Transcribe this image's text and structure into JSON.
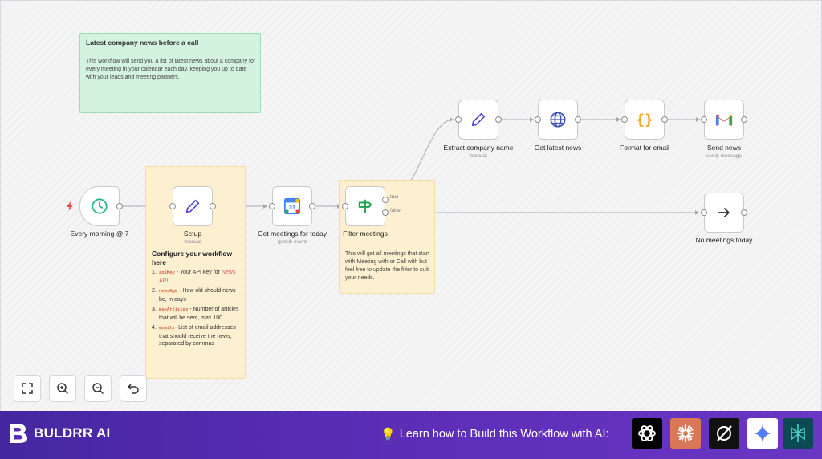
{
  "note_top": {
    "title": "Latest company news before a call",
    "body": "This workflow will send you a list of latest news about a company for every meeting in your calendar each day, keeping you up to date with your leads and meeting partners."
  },
  "note_config": {
    "title": "Configure your workflow here",
    "items": [
      {
        "n": "1.",
        "code": "apiKey",
        "text": " - Your API key for ",
        "link": "News API"
      },
      {
        "n": "2.",
        "code": "newsAge",
        "text": " - How old should news be, in days"
      },
      {
        "n": "3.",
        "code": "maxArticles",
        "text": " - Number of articles that will be sent, max 100"
      },
      {
        "n": "4.",
        "code": "emails",
        "text": "- List of email addresses that should receive the news, separated by commas"
      }
    ]
  },
  "note_filter": {
    "body": "This will get all meetings that start with Meeting with or Call with but feel free to update the filter to suit your needs."
  },
  "nodes": {
    "trigger": {
      "label": "Every morning @ 7",
      "icon": "clock-icon"
    },
    "setup": {
      "label": "Setup",
      "sub": "manual",
      "icon": "pencil-icon"
    },
    "get_meetings": {
      "label": "Get meetings for today",
      "sub": "getAll: event",
      "icon": "google-calendar-icon",
      "cal_day": "31"
    },
    "filter": {
      "label": "Filter meetings",
      "icon": "signpost-icon",
      "true_label": "true",
      "false_label": "false"
    },
    "extract": {
      "label": "Extract company name",
      "sub": "manual",
      "icon": "pencil-icon"
    },
    "get_news": {
      "label": "Get latest news",
      "icon": "globe-icon"
    },
    "format": {
      "label": "Format for email",
      "icon": "braces-icon",
      "glyph": "{}"
    },
    "send": {
      "label": "Send news",
      "sub": "send: message",
      "icon": "gmail-icon"
    },
    "no_meetings": {
      "label": "No meetings today",
      "icon": "arrow-right-icon"
    }
  },
  "controls": [
    "fit-view-icon",
    "zoom-in-icon",
    "zoom-out-icon",
    "undo-icon"
  ],
  "footer": {
    "brand": "BULDRR AI",
    "cta": "Learn how to Build this Workflow with AI:",
    "ai_buttons": [
      {
        "name": "chatgpt",
        "bg": "#000000"
      },
      {
        "name": "claude",
        "bg": "#d97757"
      },
      {
        "name": "perplexity-alt",
        "bg": "#111111"
      },
      {
        "name": "gemini",
        "bg": "#ffffff"
      },
      {
        "name": "perplexity",
        "bg": "#0b4a52"
      }
    ]
  },
  "colors": {
    "accent_purple": "#5b2db6",
    "trigger_green": "#2bb58a",
    "icon_blue": "#3f51b5",
    "format_orange": "#f5a524"
  }
}
